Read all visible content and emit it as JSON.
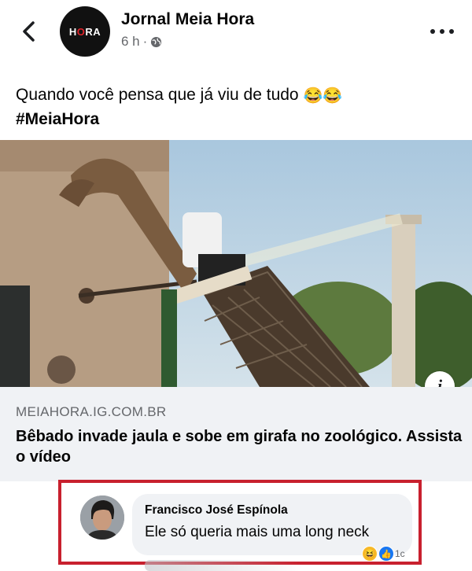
{
  "header": {
    "page_name": "Jornal Meia Hora",
    "time": "6 h",
    "separator": "·",
    "logo_text_left": "H",
    "logo_text_o": "O",
    "logo_text_right": "RA"
  },
  "post": {
    "caption_text": "Quando você pensa que já viu de tudo",
    "caption_emojis": "😂😂",
    "hashtag": "#MeiaHora"
  },
  "link_preview": {
    "domain": "MEIAHORA.IG.COM.BR",
    "title": "Bêbado invade jaula e sobe em girafa no zoológico. Assista o vídeo",
    "info_label": "i"
  },
  "comment": {
    "author": "Francisco José Espínola",
    "text": "Ele só queria mais uma long neck",
    "reaction_count": "1c",
    "reactions": [
      "haha",
      "like"
    ]
  },
  "colors": {
    "highlight_border": "#c8202e",
    "bubble_bg": "#f0f2f5",
    "link_box_bg": "#f0f2f5",
    "secondary_text": "#65676b",
    "logo_accent": "#e0232a"
  }
}
